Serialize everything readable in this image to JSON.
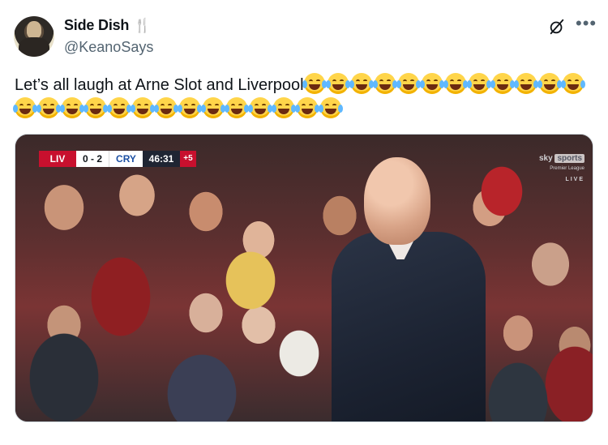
{
  "author": {
    "display_name": "Side Dish",
    "name_emoji": "🍴",
    "handle": "@KeanoSays"
  },
  "header_icons": [
    "grok-icon",
    "more-icon"
  ],
  "tweet": {
    "text": "Let’s all laugh at Arne Slot and Liverpool",
    "emoji_name": "joy-emoji",
    "emoji_count": 26
  },
  "media": {
    "scorebug": {
      "home": "LIV",
      "score": "0 - 2",
      "away": "CRY",
      "clock": "46:31",
      "added_time": "+5"
    },
    "broadcaster": {
      "brand": "sky",
      "product": "sports",
      "subtitle": "Premier League",
      "status": "LIVE"
    }
  },
  "colors": {
    "liverpool_red": "#c8102e",
    "crystal_palace_blue": "#1b4fa3",
    "text_primary": "#0f1419",
    "text_secondary": "#536471"
  }
}
